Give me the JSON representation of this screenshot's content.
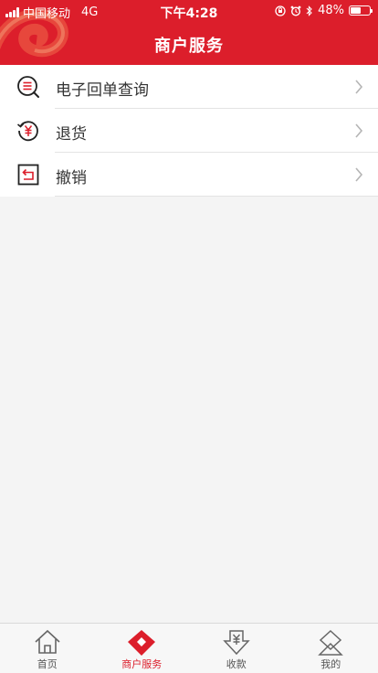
{
  "status_bar": {
    "carrier": "中国移动",
    "network": "4G",
    "time": "下午4:28",
    "battery": "48%"
  },
  "header": {
    "title": "商户服务"
  },
  "menu": {
    "items": [
      {
        "label": "电子回单查询",
        "icon": "search-list-icon"
      },
      {
        "label": "退货",
        "icon": "refund-yuan-icon"
      },
      {
        "label": "撤销",
        "icon": "undo-icon"
      }
    ]
  },
  "tabbar": {
    "items": [
      {
        "label": "首页",
        "icon": "home-icon"
      },
      {
        "label": "商户服务",
        "icon": "merchant-diamond-icon"
      },
      {
        "label": "收款",
        "icon": "receive-yuan-icon"
      },
      {
        "label": "我的",
        "icon": "profile-icon"
      }
    ]
  },
  "colors": {
    "accent": "#dc1e2b",
    "background": "#f4f4f4"
  }
}
